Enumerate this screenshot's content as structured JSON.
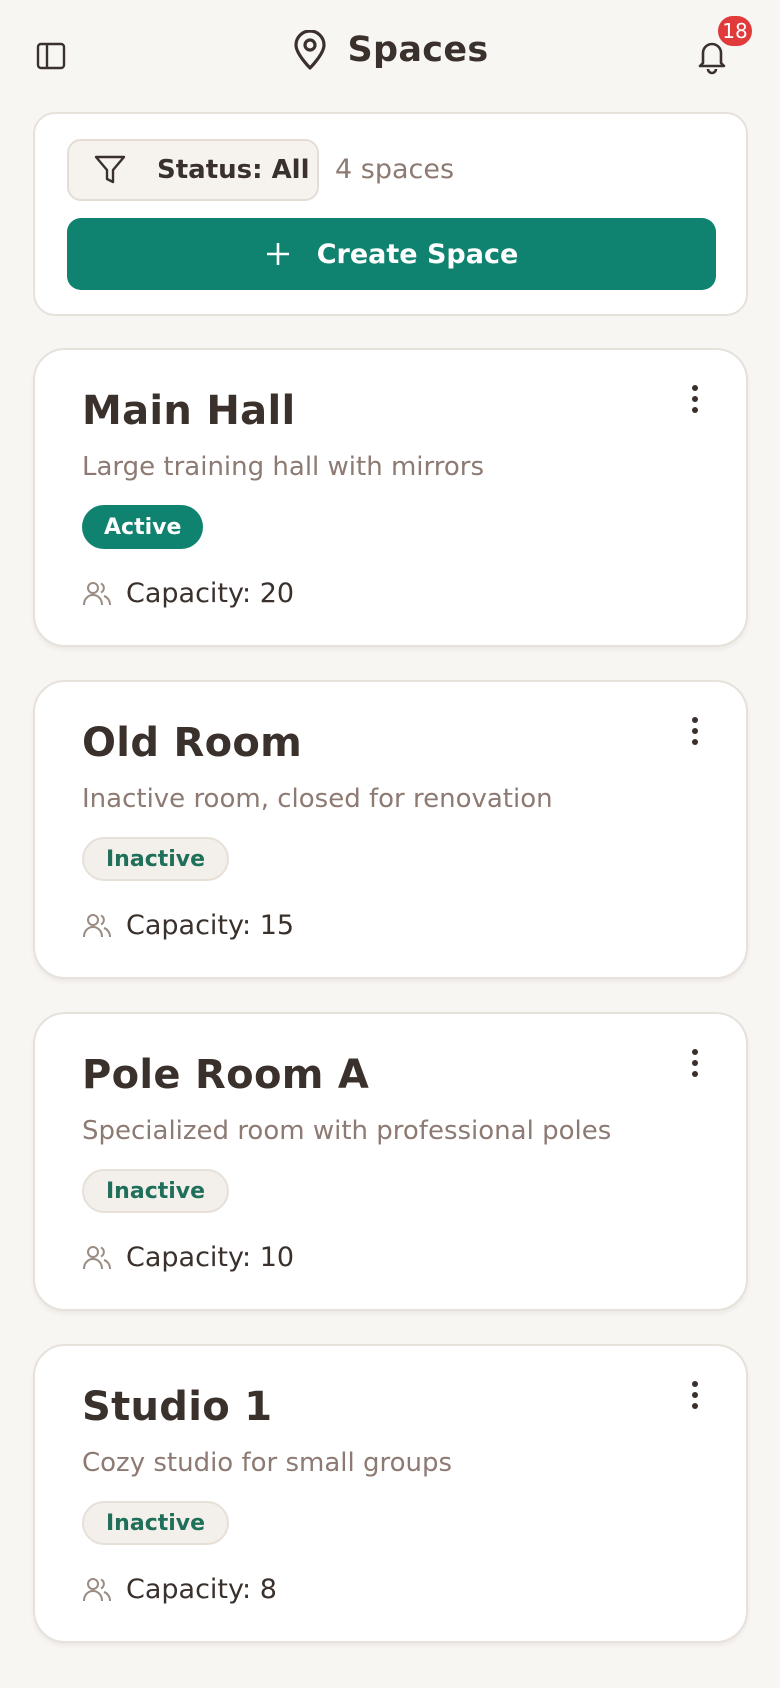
{
  "header": {
    "title": "Spaces",
    "notification_count": "18"
  },
  "toolbar": {
    "filter_label": "Status: All",
    "count_text": "4 spaces",
    "create_label": "Create Space"
  },
  "colors": {
    "accent": "#0f8270",
    "badge": "#e03a3a",
    "background": "#f8f6f3"
  },
  "spaces": [
    {
      "name": "Main Hall",
      "description": "Large training hall with mirrors",
      "status": "Active",
      "capacity": "Capacity: 20"
    },
    {
      "name": "Old Room",
      "description": "Inactive room, closed for renovation",
      "status": "Inactive",
      "capacity": "Capacity: 15"
    },
    {
      "name": "Pole Room A",
      "description": "Specialized room with professional poles",
      "status": "Inactive",
      "capacity": "Capacity: 10"
    },
    {
      "name": "Studio 1",
      "description": "Cozy studio for small groups",
      "status": "Inactive",
      "capacity": "Capacity: 8"
    }
  ]
}
